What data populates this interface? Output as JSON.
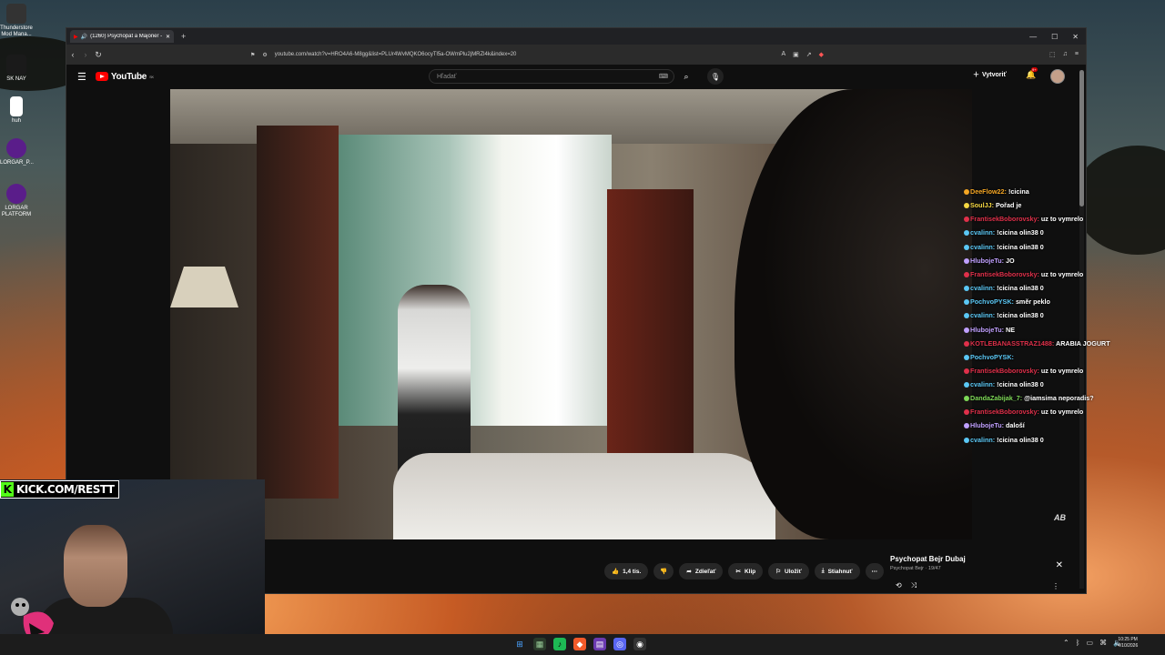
{
  "desktop": {
    "icons": [
      {
        "label": "Thunderstore Mod Mana...",
        "icon": "thunderstore-icon",
        "color": "#ffffff"
      },
      {
        "label": "SK NAY",
        "icon": "sk-nay-icon",
        "color": "#222222"
      },
      {
        "label": "huh",
        "icon": "file-icon",
        "color": "#ffffff"
      },
      {
        "label": "LORGAR_P...",
        "icon": "lorgar-icon",
        "color": "#8a2be2"
      },
      {
        "label": "LORGAR PLATFORM",
        "icon": "lorgar-platform-icon",
        "color": "#8a2be2"
      }
    ]
  },
  "browser": {
    "tab_title": "(1260) Psychopat a Majoner -",
    "url": "youtube.com/watch?v=HRO4A6-M8gg&list=PLUr4WvMQKO6ocyTl5a-OWmPlu2jMRZl4k&index=20"
  },
  "youtube": {
    "logo_text": "YouTube",
    "logo_region": "SK",
    "search_placeholder": "Hľadať",
    "create_label": "Vytvoriť",
    "notification_count": "9+"
  },
  "chat": [
    {
      "user": "DeeFlow22:",
      "msg": "!cicina",
      "color": "#f5a623"
    },
    {
      "user": "SoulJJ:",
      "msg": "Pořad je",
      "color": "#f5d742"
    },
    {
      "user": "FrantisekBoborovsky:",
      "msg": "uz to vymrelo",
      "color": "#e0304a"
    },
    {
      "user": "cvalinn:",
      "msg": "!cicina olin38 0",
      "color": "#5bc8f5"
    },
    {
      "user": "cvalinn:",
      "msg": "!cicina olin38 0",
      "color": "#5bc8f5"
    },
    {
      "user": "HlubojeTu:",
      "msg": "JO",
      "color": "#c0a0ff"
    },
    {
      "user": "FrantisekBoborovsky:",
      "msg": "uz to vymrelo",
      "color": "#e0304a"
    },
    {
      "user": "cvalinn:",
      "msg": "!cicina olin38 0",
      "color": "#5bc8f5"
    },
    {
      "user": "PochvoPYSK:",
      "msg": "směr peklo",
      "color": "#5bc8f5"
    },
    {
      "user": "cvalinn:",
      "msg": "!cicina olin38 0",
      "color": "#5bc8f5"
    },
    {
      "user": "HlubojeTu:",
      "msg": "NE",
      "color": "#c0a0ff"
    },
    {
      "user": "KOTLEBANASSTRAZ1488:",
      "msg": "ARABIA JOGURT",
      "color": "#e0304a"
    },
    {
      "user": "PochvoPYSK:",
      "msg": "",
      "color": "#5bc8f5"
    },
    {
      "user": "FrantisekBoborovsky:",
      "msg": "uz to vymrelo",
      "color": "#e0304a"
    },
    {
      "user": "cvalinn:",
      "msg": "!cicina olin38 0",
      "color": "#5bc8f5"
    },
    {
      "user": "DandaZabijak_7:",
      "msg": "@iamsima neporadis?",
      "color": "#7ed957"
    },
    {
      "user": "FrantisekBoborovsky:",
      "msg": "uz to vymrelo",
      "color": "#e0304a"
    },
    {
      "user": "HlubojeTu:",
      "msg": "daloší",
      "color": "#c0a0ff"
    },
    {
      "user": "cvalinn:",
      "msg": "!cicina olin38 0",
      "color": "#5bc8f5"
    }
  ],
  "actions": {
    "likes": "1,4 tis.",
    "share": "Zdieľať",
    "clip": "Klip",
    "save": "Uložiť",
    "download": "Stiahnuť"
  },
  "playlist": {
    "title": "Psychopat Bejr  Dubaj",
    "channel": "Psychopat Bejr",
    "position": "19/47"
  },
  "stream": {
    "kick_text": "KICK.COM/RESTT",
    "watermark": "AB"
  },
  "taskbar": {
    "time": "10:25 PM",
    "date": "4/10/2026"
  }
}
